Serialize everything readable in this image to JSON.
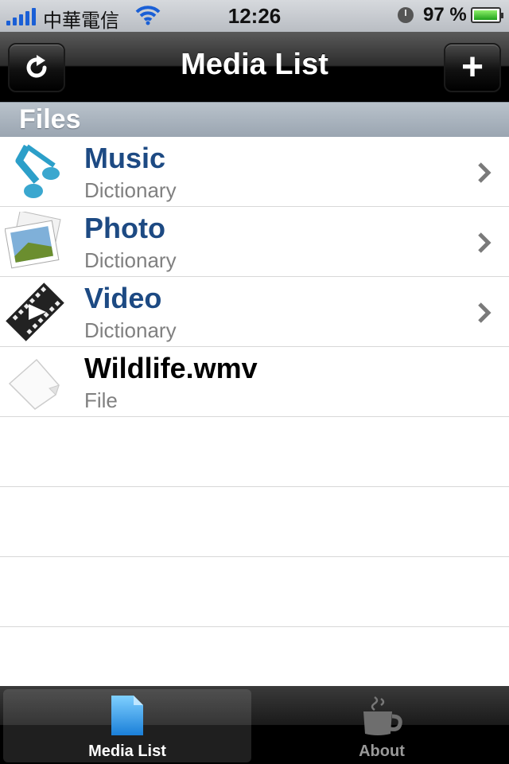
{
  "status": {
    "carrier": "中華電信",
    "time": "12:26",
    "battery_percent": "97 %",
    "battery_level": 0.97,
    "icons": [
      "signal-icon",
      "wifi-icon",
      "alarm-icon",
      "battery-icon"
    ]
  },
  "navbar": {
    "title": "Media List",
    "refresh_icon": "refresh-icon",
    "add_icon": "plus-icon",
    "add_label": "+"
  },
  "section": {
    "header": "Files"
  },
  "rows": [
    {
      "title": "Music",
      "subtitle": "Dictionary",
      "icon": "music-note-icon"
    },
    {
      "title": "Photo",
      "subtitle": "Dictionary",
      "icon": "photo-icon"
    },
    {
      "title": "Video",
      "subtitle": "Dictionary",
      "icon": "film-icon"
    },
    {
      "title": "Wildlife.wmv",
      "subtitle": "File",
      "icon": "file-icon"
    }
  ],
  "tabbar": {
    "tabs": [
      {
        "label": "Media List",
        "icon": "document-icon",
        "selected": true
      },
      {
        "label": "About",
        "icon": "coffee-cup-icon",
        "selected": false
      }
    ]
  },
  "colors": {
    "title_blue": "#1d4a83",
    "subtitle_gray": "#808080",
    "section_bg": "#a9b3be"
  }
}
